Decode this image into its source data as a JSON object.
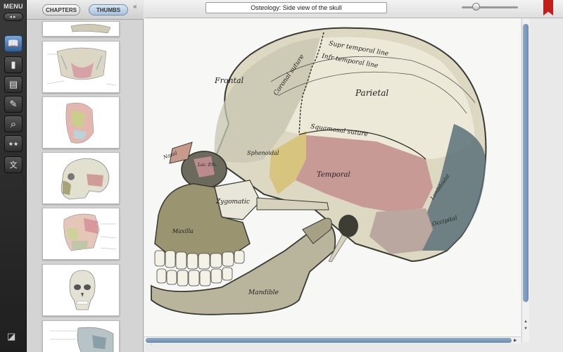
{
  "menu": {
    "label": "MENU",
    "toggle": "◂▸",
    "tools": [
      {
        "name": "book-icon",
        "glyph": "📖",
        "active": true
      },
      {
        "name": "bookmark-icon",
        "glyph": "▮",
        "active": false
      },
      {
        "name": "document-icon",
        "glyph": "▤",
        "active": false
      },
      {
        "name": "pencil-icon",
        "glyph": "✎",
        "active": false
      },
      {
        "name": "search-icon",
        "glyph": "⌕",
        "active": false
      },
      {
        "name": "stars-icon",
        "glyph": "★★",
        "active": false
      },
      {
        "name": "translate-icon",
        "glyph": "文",
        "active": false
      }
    ],
    "corner_glyph": "◪"
  },
  "panel": {
    "chapters_label": "CHAPTERS",
    "thumbs_label": "THUMBS",
    "collapse_glyph": "«"
  },
  "viewer": {
    "title": "Osteology: Side view of the skull",
    "zoom_level": 0.25
  },
  "skull_labels": {
    "frontal": "Frontal",
    "coronal": "Coronal suture",
    "supr_temporal": "Supr temporal line",
    "infr_temporal": "Infr temporal line",
    "parietal": "Parietal",
    "squamosal": "Squamosal suture",
    "sphenoidal": "Sphenoidal",
    "temporal": "Temporal",
    "nasal": "Nasal",
    "lachrymal": "Lac. Eth.",
    "zygomatic": "Zygomatic",
    "maxilla": "Maxilla",
    "mandible": "Mandible",
    "occipital": "Occipital",
    "lambdoidal": "Lambdoidal"
  },
  "colors": {
    "bone": "#dcd8c2",
    "frontal_shade": "#c8c6b0",
    "parietal": "#ece9d8",
    "temporal": "#c89a96",
    "sphenoid": "#d7c47e",
    "occipital": "#5a7178",
    "maxilla": "#9a9470",
    "accent_blue": "#6e8db0",
    "ribbon": "#c21c1c"
  }
}
